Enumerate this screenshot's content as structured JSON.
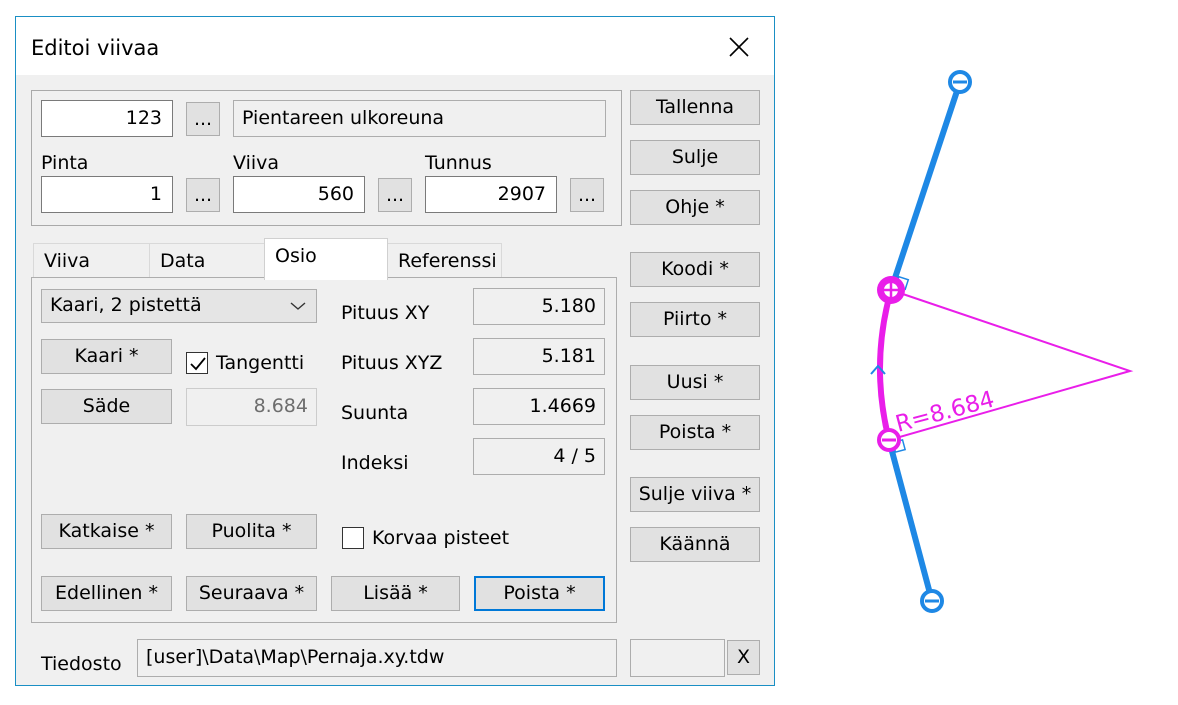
{
  "dialog": {
    "title": "Editoi viivaa",
    "code_value": "123",
    "description": "Pientareen ulkoreuna",
    "browse_label": "...",
    "labels": {
      "pinta": "Pinta",
      "viiva": "Viiva",
      "tunnus": "Tunnus"
    },
    "pinta_value": "1",
    "viiva_value": "560",
    "tunnus_value": "2907"
  },
  "side_buttons": {
    "save": "Tallenna",
    "close": "Sulje",
    "help": "Ohje *",
    "code": "Koodi *",
    "draw": "Piirto *",
    "new": "Uusi *",
    "delete": "Poista *",
    "close_line": "Sulje viiva *",
    "reverse": "Käännä"
  },
  "tabs": [
    "Viiva",
    "Data",
    "Osio",
    "Referenssi"
  ],
  "osio": {
    "mode_select": "Kaari, 2 pistettä",
    "arc_button": "Kaari *",
    "tangent_label": "Tangentti",
    "tangent_checked": true,
    "radius_button": "Säde",
    "radius_value": "8.684",
    "stats": {
      "length_xy_label": "Pituus XY",
      "length_xy": "5.180",
      "length_xyz_label": "Pituus XYZ",
      "length_xyz": "5.181",
      "direction_label": "Suunta",
      "direction": "1.4669",
      "index_label": "Indeksi",
      "index": "4 / 5"
    },
    "split_button": "Katkaise *",
    "halve_button": "Puolita *",
    "replace_points_label": "Korvaa pisteet",
    "replace_points_checked": false,
    "prev_button": "Edellinen *",
    "next_button": "Seuraava *",
    "add_button": "Lisää *",
    "delete_button": "Poista *"
  },
  "file": {
    "label": "Tiedosto",
    "path": "[user]\\Data\\Map\\Pernaja.xy.tdw",
    "clear_label": "X"
  },
  "canvas": {
    "radius_label": "R=8.684",
    "line_color": "#1e88e5",
    "arc_color": "#e91ee9"
  }
}
